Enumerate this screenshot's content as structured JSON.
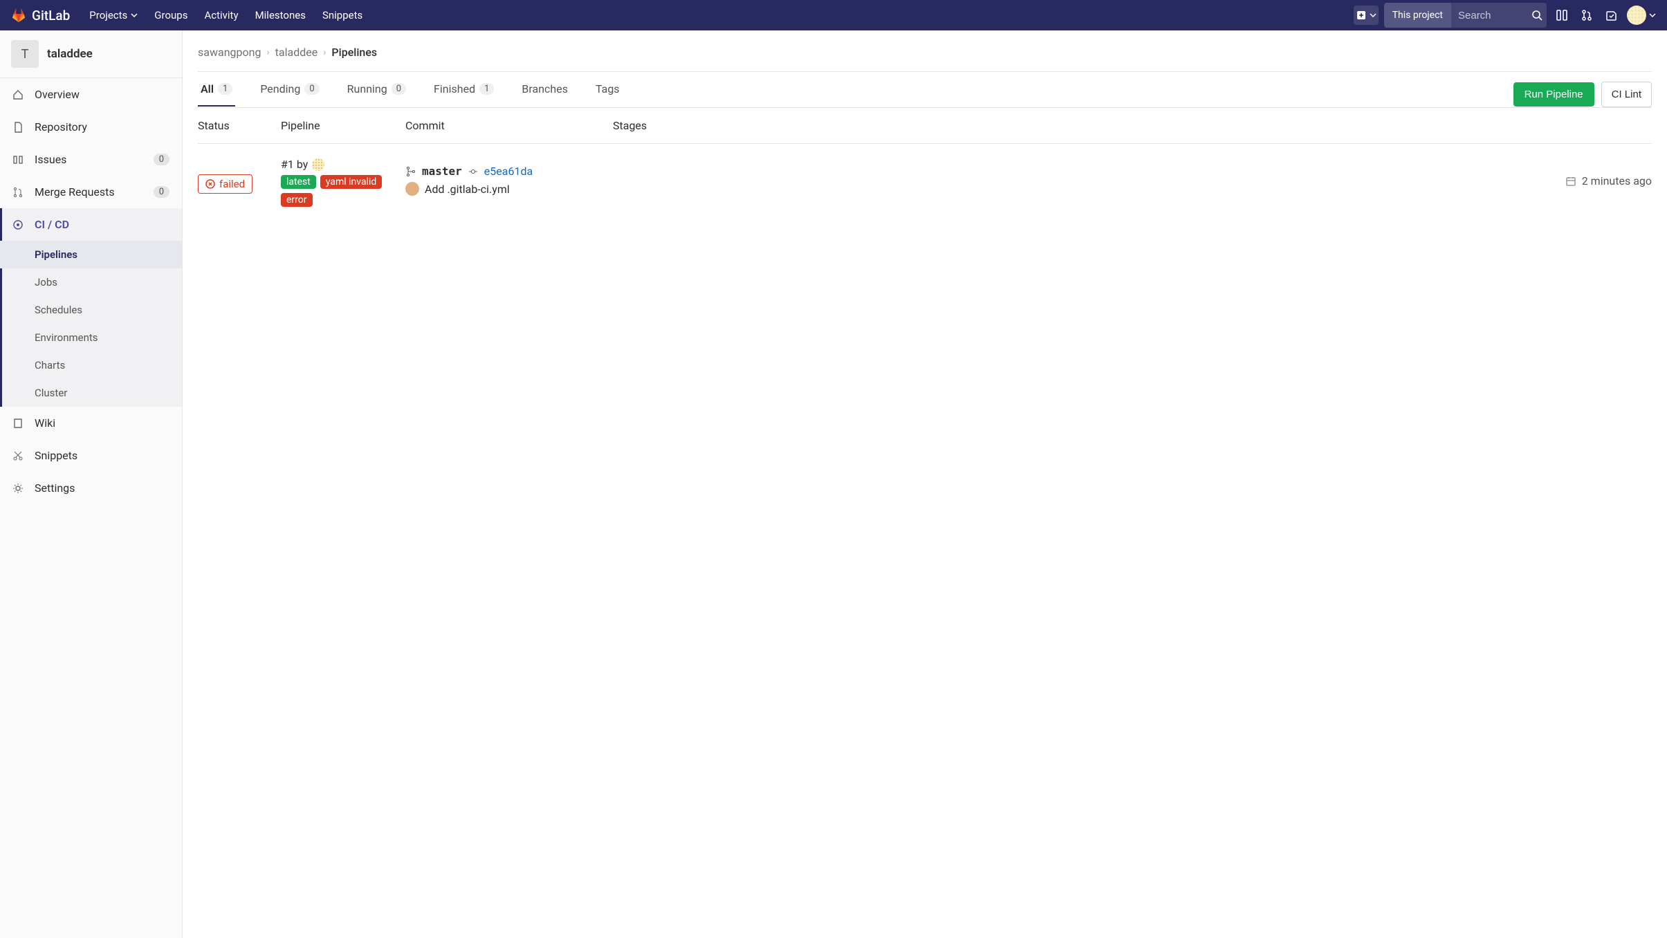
{
  "navbar": {
    "brand": "GitLab",
    "links": {
      "projects": "Projects",
      "groups": "Groups",
      "activity": "Activity",
      "milestones": "Milestones",
      "snippets": "Snippets"
    },
    "search_scope": "This project",
    "search_placeholder": "Search"
  },
  "sidebar": {
    "project_letter": "T",
    "project_name": "taladdee",
    "items": [
      {
        "label": "Overview"
      },
      {
        "label": "Repository"
      },
      {
        "label": "Issues",
        "count": "0"
      },
      {
        "label": "Merge Requests",
        "count": "0"
      },
      {
        "label": "CI / CD",
        "active": true
      },
      {
        "label": "Wiki"
      },
      {
        "label": "Snippets"
      },
      {
        "label": "Settings"
      }
    ],
    "cicd_sub": [
      {
        "label": "Pipelines",
        "active": true
      },
      {
        "label": "Jobs"
      },
      {
        "label": "Schedules"
      },
      {
        "label": "Environments"
      },
      {
        "label": "Charts"
      },
      {
        "label": "Cluster"
      }
    ]
  },
  "breadcrumbs": {
    "owner": "sawangpong",
    "project": "taladdee",
    "page": "Pipelines"
  },
  "tabs": [
    {
      "label": "All",
      "count": "1",
      "active": true
    },
    {
      "label": "Pending",
      "count": "0"
    },
    {
      "label": "Running",
      "count": "0"
    },
    {
      "label": "Finished",
      "count": "1"
    },
    {
      "label": "Branches"
    },
    {
      "label": "Tags"
    }
  ],
  "buttons": {
    "run": "Run Pipeline",
    "lint": "CI Lint"
  },
  "table": {
    "headers": {
      "status": "Status",
      "pipeline": "Pipeline",
      "commit": "Commit",
      "stages": "Stages"
    },
    "rows": [
      {
        "status": "failed",
        "pipeline_id": "#1 by",
        "labels": [
          {
            "text": "latest",
            "color": "green"
          },
          {
            "text": "yaml invalid",
            "color": "red"
          },
          {
            "text": "error",
            "color": "red"
          }
        ],
        "branch": "master",
        "sha": "e5ea61da",
        "message": "Add .gitlab-ci.yml",
        "time": "2 minutes ago"
      }
    ]
  }
}
